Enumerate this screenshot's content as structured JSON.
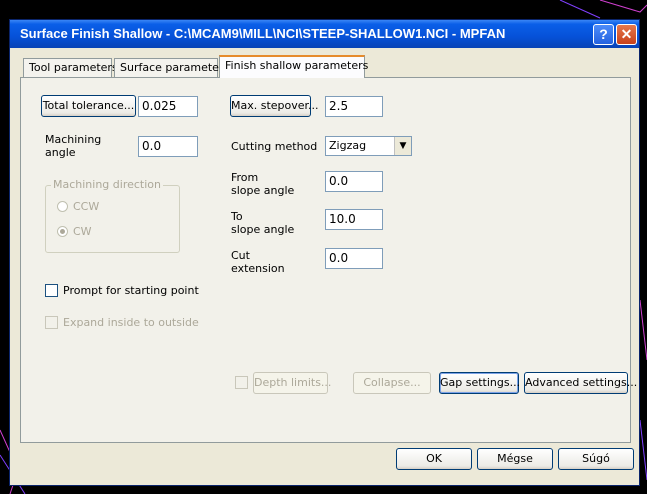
{
  "window": {
    "title": "Surface Finish Shallow - C:\\MCAM9\\MILL\\NCI\\STEEP-SHALLOW1.NCI - MPFAN",
    "help_glyph": "?",
    "close_glyph": "✕"
  },
  "tabs": [
    {
      "label": "Tool parameters"
    },
    {
      "label": "Surface parameters"
    },
    {
      "label": "Finish shallow parameters"
    }
  ],
  "fields": {
    "total_tolerance_label": "Total tolerance...",
    "total_tolerance": "0.025",
    "machining_angle_label_1": "Machining",
    "machining_angle_label_2": "angle",
    "machining_angle": "0.0",
    "max_stepover_label": "Max. stepover...",
    "max_stepover": "2.5",
    "cutting_method_label": "Cutting method",
    "cutting_method": "Zigzag",
    "from_slope_label_1": "From",
    "from_slope_label_2": "slope angle",
    "from_slope": "0.0",
    "to_slope_label_1": "To",
    "to_slope_label_2": "slope angle",
    "to_slope": "10.0",
    "cut_ext_label_1": "Cut",
    "cut_ext_label_2": "extension",
    "cut_extension": "0.0"
  },
  "machining_direction": {
    "title": "Machining direction",
    "ccw": "CCW",
    "cw": "CW"
  },
  "checkboxes": {
    "prompt_start": "Prompt for starting point",
    "expand_inside": "Expand inside to outside"
  },
  "buttons": {
    "depth_limits": "Depth limits...",
    "collapse": "Collapse...",
    "gap_settings": "Gap settings...",
    "advanced_settings": "Advanced settings...",
    "ok": "OK",
    "cancel": "Mégse",
    "help": "Súgó"
  }
}
